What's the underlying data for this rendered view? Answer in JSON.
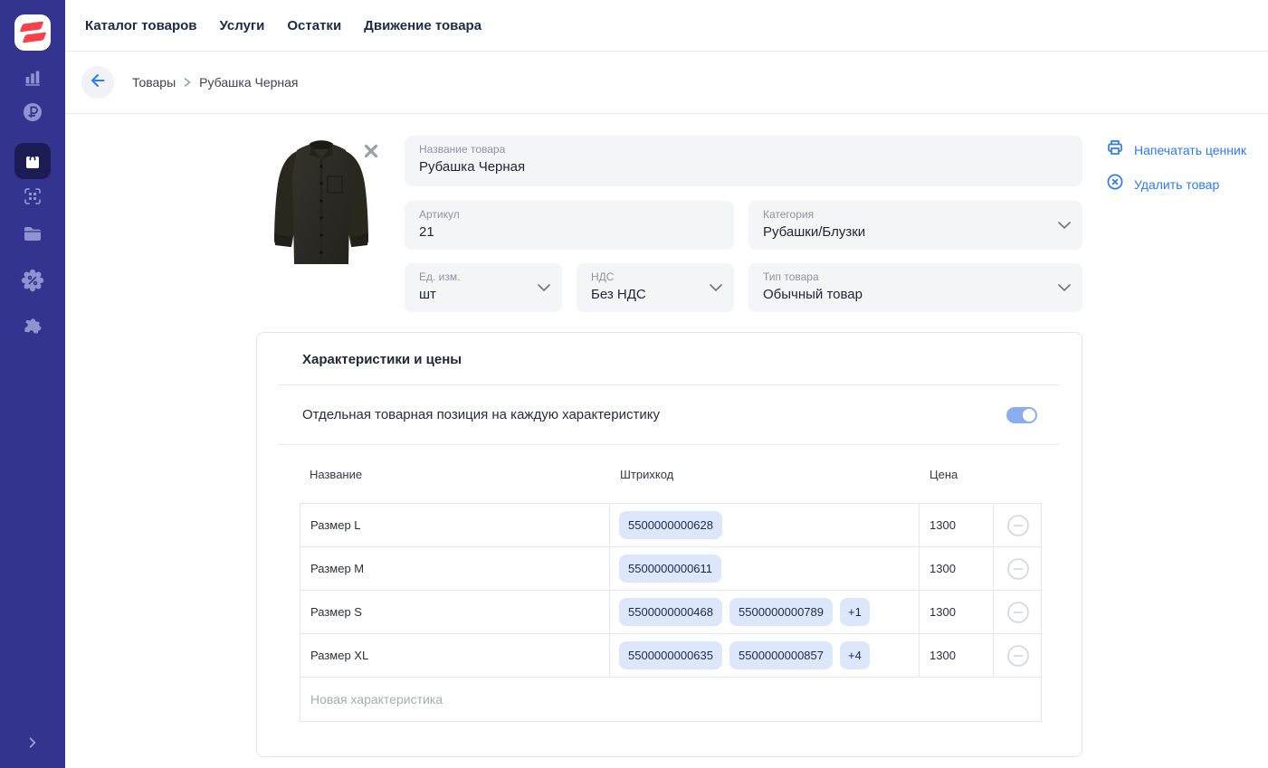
{
  "nav": {
    "items": [
      "Каталог товаров",
      "Услуги",
      "Остатки",
      "Движение товара"
    ]
  },
  "sidebar": {
    "icons": [
      "analytics",
      "ruble",
      "products",
      "scan",
      "files",
      "discounts",
      "integrations"
    ],
    "active": "products",
    "expand_icon": "chevron-right"
  },
  "breadcrumb": {
    "items": [
      "Товары",
      "Рубашка Черная"
    ]
  },
  "actions": {
    "print_label": "Напечатать ценник",
    "delete_label": "Удалить товар"
  },
  "form": {
    "name": {
      "label": "Название товара",
      "value": "Рубашка Черная"
    },
    "sku": {
      "label": "Артикул",
      "value": "21"
    },
    "category": {
      "label": "Категория",
      "value": "Рубашки/Блузки"
    },
    "unit": {
      "label": "Ед. изм.",
      "value": "шт"
    },
    "vat": {
      "label": "НДС",
      "value": "Без НДС"
    },
    "type": {
      "label": "Тип товара",
      "value": "Обычный товар"
    }
  },
  "characteristics": {
    "title": "Характеристики и цены",
    "toggle_label": "Отдельная товарная позиция на каждую характеристику",
    "toggle_on": true,
    "table": {
      "headers": [
        "Название",
        "Штрихкод",
        "Цена"
      ],
      "rows": [
        {
          "name": "Размер L",
          "barcodes": [
            "5500000000628"
          ],
          "more": "",
          "price": "1300"
        },
        {
          "name": "Размер M",
          "barcodes": [
            "5500000000611"
          ],
          "more": "",
          "price": "1300"
        },
        {
          "name": "Размер S",
          "barcodes": [
            "5500000000468",
            "5500000000789"
          ],
          "more": "+1",
          "price": "1300"
        },
        {
          "name": "Размер XL",
          "barcodes": [
            "5500000000635",
            "5500000000857"
          ],
          "more": "+4",
          "price": "1300"
        }
      ],
      "new_row_placeholder": "Новая характеристика"
    }
  },
  "colors": {
    "sidebar_bg": "#333390",
    "sidebar_active_bg": "#1c1c55",
    "sidebar_icon": "#8f94cf",
    "accent_blue": "#2d7bf4",
    "chip_bg": "#dde7fc",
    "toggle_on": "#8badf0",
    "field_bg": "#f4f5f7",
    "logo_red": "#f4434b"
  }
}
